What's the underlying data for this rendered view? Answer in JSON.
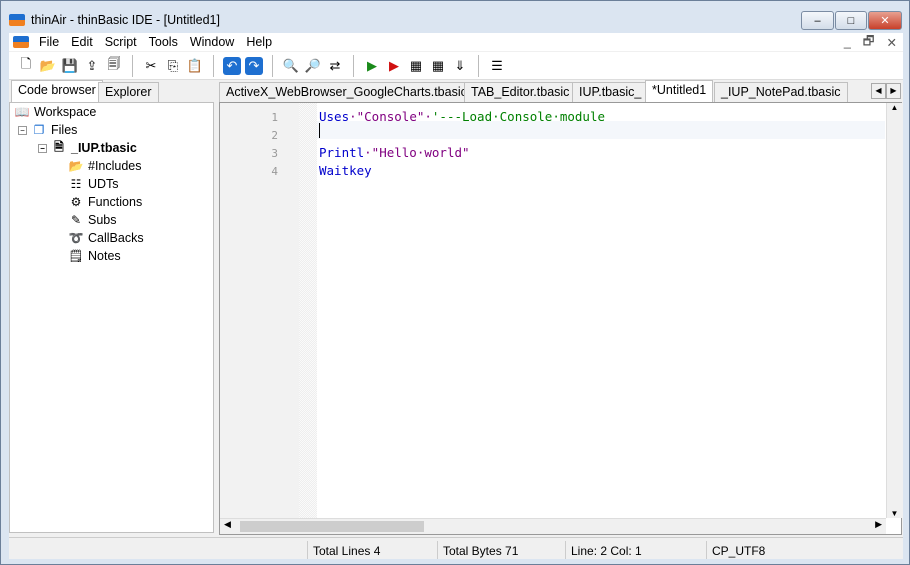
{
  "window": {
    "title": "thinAir - thinBasic IDE - [Untitled1]",
    "minimize": "–",
    "maximize": "□",
    "close": "✕"
  },
  "menu": [
    "File",
    "Edit",
    "Script",
    "Tools",
    "Window",
    "Help"
  ],
  "mdi_controls": [
    "_",
    "🗗",
    "✕"
  ],
  "toolbar": [
    {
      "name": "new-file-icon",
      "g": "🗋"
    },
    {
      "name": "open-icon",
      "g": "📂"
    },
    {
      "name": "save-icon",
      "g": "💾"
    },
    {
      "name": "save-as-icon",
      "g": "⇪"
    },
    {
      "name": "save-all-icon",
      "g": "🗐"
    },
    {
      "sep": true
    },
    {
      "name": "cut-icon",
      "g": "✂"
    },
    {
      "name": "copy-icon",
      "g": "⎘"
    },
    {
      "name": "paste-icon",
      "g": "📋"
    },
    {
      "sep": true
    },
    {
      "name": "undo-icon",
      "g": "↶"
    },
    {
      "name": "redo-icon",
      "g": "↷"
    },
    {
      "sep": true
    },
    {
      "name": "find-icon",
      "g": "🔍"
    },
    {
      "name": "find-next-icon",
      "g": "🔎"
    },
    {
      "name": "replace-icon",
      "g": "⇄"
    },
    {
      "sep": true
    },
    {
      "name": "run-icon",
      "g": "▶"
    },
    {
      "name": "run-debug-icon",
      "g": "▶"
    },
    {
      "name": "obfuscate-icon",
      "g": "▦"
    },
    {
      "name": "bundle-icon",
      "g": "▦"
    },
    {
      "name": "download-icon",
      "g": "⇓"
    },
    {
      "sep": true
    },
    {
      "name": "options-icon",
      "g": "☰"
    }
  ],
  "panel_tabs": [
    "Code browser",
    "Explorer"
  ],
  "tree": {
    "workspace": "Workspace",
    "files": "Files",
    "file": "_IUP.tbasic",
    "children": [
      "#Includes",
      "UDTs",
      "Functions",
      "Subs",
      "CallBacks",
      "Notes"
    ]
  },
  "editor_tabs": [
    "ActiveX_WebBrowser_GoogleCharts.tbasic",
    "TAB_Editor.tbasic",
    "IUP.tbasic_",
    "*Untitled1",
    "_IUP_NotePad.tbasic"
  ],
  "active_tab": 3,
  "code": {
    "line_numbers": [
      "1",
      "2",
      "3",
      "4"
    ],
    "l1_kw": "Uses",
    "l1_str": "·\"Console\"·",
    "l1_cm": "'---Load·Console·module",
    "l3_kw": "Printl",
    "l3_str": "·\"Hello·world\"",
    "l4_kw": "Waitkey"
  },
  "colors": {
    "keyword": "#0000cc",
    "string": "#800080",
    "comment": "#008000"
  },
  "status": {
    "total_lines": "Total Lines 4",
    "total_bytes": "Total Bytes 71",
    "position": "Line: 2 Col: 1",
    "encoding": "CP_UTF8"
  }
}
